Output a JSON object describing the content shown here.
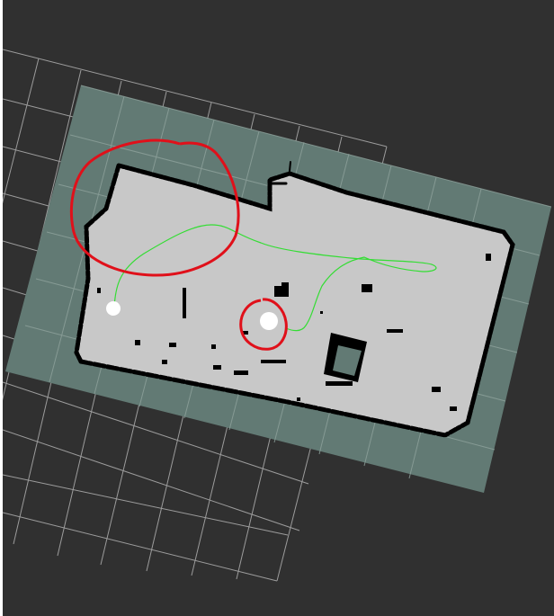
{
  "scene": {
    "background_color": "#303030",
    "grid_color": "#a8a8a8",
    "costmap_color": "#627a74",
    "free_space_color": "#c8c8c8",
    "obstacle_color": "#000000",
    "path_color": "#33dd33",
    "annotation_color": "#e0101a",
    "robot_marker_color": "#ffffff"
  },
  "icons": {
    "start_marker": "circle",
    "robot_marker": "circle"
  }
}
